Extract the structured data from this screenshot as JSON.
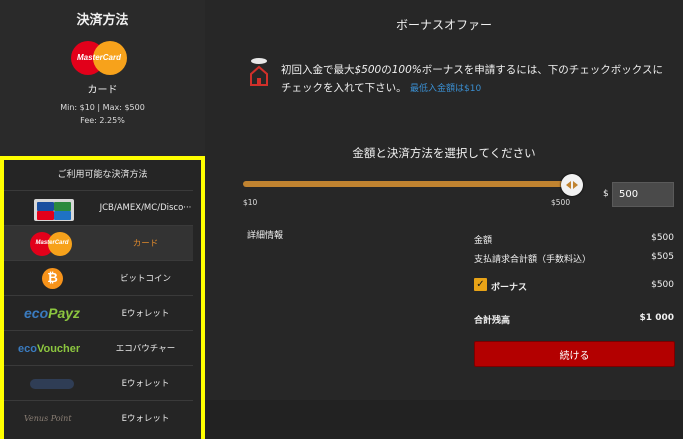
{
  "payment_panel": {
    "title": "決済方法",
    "selected_label": "カード",
    "limits": "Min: $10 | Max: $500",
    "fee": "Fee: 2.25%"
  },
  "available_methods": {
    "title": "ご利用可能な決済方法",
    "items": [
      {
        "label": "JCB/AMEX/MC/Disco···",
        "icon": "credit-cards-icon"
      },
      {
        "label": "カード",
        "icon": "mastercard-icon",
        "active": true
      },
      {
        "label": "ビットコイン",
        "icon": "bitcoin-icon"
      },
      {
        "label": "Eウォレット",
        "icon": "ecopayz-logo",
        "logo_text_a": "eco",
        "logo_text_b": "Payz"
      },
      {
        "label": "エコバウチャー",
        "icon": "ecovoucher-logo",
        "logo_text_a": "eco",
        "logo_text_b": "Voucher"
      },
      {
        "label": "Eウォレット",
        "icon": "ewallet-logo"
      },
      {
        "label": "Eウォレット",
        "icon": "venuspoint-logo",
        "logo_text": "Venus Point"
      }
    ]
  },
  "mastercard_text": "MasterCard",
  "bonus": {
    "title": "ボーナスオファー",
    "text_part1": "初回入金で最大",
    "text_amount": "$500",
    "text_part2": "の",
    "text_percent": "100%",
    "text_part3": "ボーナスを申請するには、下のチェックボックスにチェックを入れて下さい。",
    "min_deposit": "最低入金額は$10"
  },
  "amount_section": {
    "title": "金額と決済方法を選択してください",
    "slider_min": "$10",
    "slider_max": "$500",
    "slider_fraction": 1.0,
    "currency": "$",
    "amount_value": "500"
  },
  "details": {
    "title": "詳細情報",
    "amount_label": "金額",
    "amount_value": "$500",
    "total_charge_label": "支払請求合計額（手数料込）",
    "total_charge_value": "$505",
    "bonus_label": "ボーナス",
    "bonus_checked": true,
    "bonus_value": "$500",
    "total_balance_label": "合計残高",
    "total_balance_value": "$1 000",
    "continue_label": "続ける"
  },
  "colors": {
    "accent_orange": "#c08330",
    "continue_red": "#b30000",
    "highlight_yellow": "#ffff00",
    "link_blue": "#3a8ed0"
  }
}
